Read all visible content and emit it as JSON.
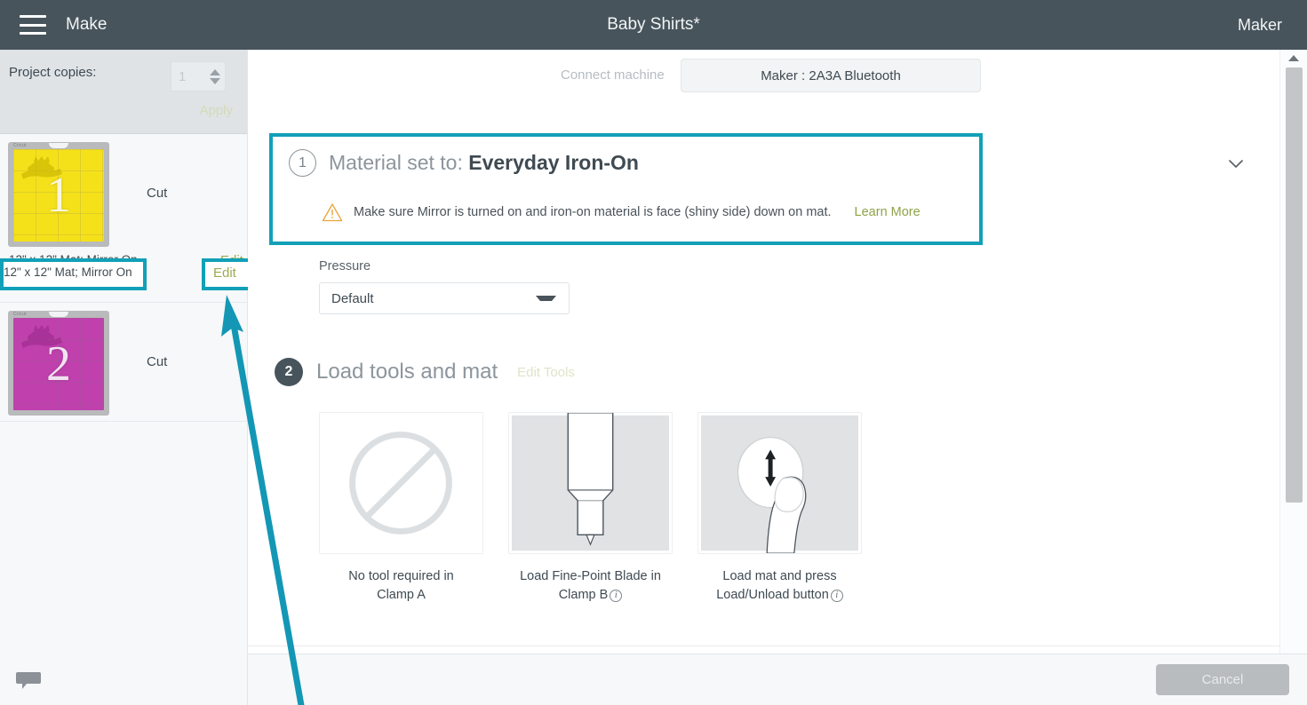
{
  "topbar": {
    "menu_icon": "hamburger-menu-icon",
    "make_label": "Make",
    "project_title": "Baby Shirts*",
    "machine_label": "Maker"
  },
  "sidebar": {
    "copies_label": "Project copies:",
    "copies_value": "1",
    "apply_label": "Apply",
    "mats": [
      {
        "number": "1",
        "action_label": "Cut",
        "meta_label": "12\" x 12\" Mat; Mirror On",
        "edit_label": "Edit",
        "mat_color": "#f5e11a",
        "brand_label": "Cricut"
      },
      {
        "number": "2",
        "action_label": "Cut",
        "mat_color": "#c040ae",
        "brand_label": "Cricut"
      }
    ]
  },
  "main": {
    "connect_label": "Connect machine",
    "machine_button_label": "Maker : 2A3A Bluetooth",
    "step1": {
      "number": "1",
      "title_prefix": "Material set to:",
      "material": "Everyday Iron-On",
      "warning_icon": "warning-triangle-icon",
      "warning_text": "Make sure Mirror is turned on and iron-on material is face (shiny side) down on mat.",
      "learn_more_label": "Learn More",
      "collapse_icon": "chevron-down-icon"
    },
    "pressure": {
      "label": "Pressure",
      "value": "Default"
    },
    "step2": {
      "number": "2",
      "title": "Load tools and mat",
      "edit_tools_label": "Edit Tools",
      "tools": [
        {
          "icon": "no-tool-circle-slash-icon",
          "caption_line1": "No tool required in",
          "caption_line2": "Clamp A",
          "has_info": false
        },
        {
          "icon": "fine-point-blade-icon",
          "caption_line1": "Load Fine-Point Blade in",
          "caption_line2": "Clamp B",
          "has_info": true
        },
        {
          "icon": "load-unload-button-press-icon",
          "caption_line1": "Load mat and press",
          "caption_line2": "Load/Unload button",
          "has_info": true
        }
      ]
    }
  },
  "bottombar": {
    "chat_icon": "chat-bubble-icon",
    "cancel_label": "Cancel"
  },
  "annotations": {
    "highlight_color": "#12a0b8",
    "arrow_color": "#1397b5",
    "arrow_target": "edit-link"
  },
  "scrollbar": {
    "up_icon": "scroll-up-arrow-icon",
    "down_icon": "scroll-down-arrow-icon"
  }
}
